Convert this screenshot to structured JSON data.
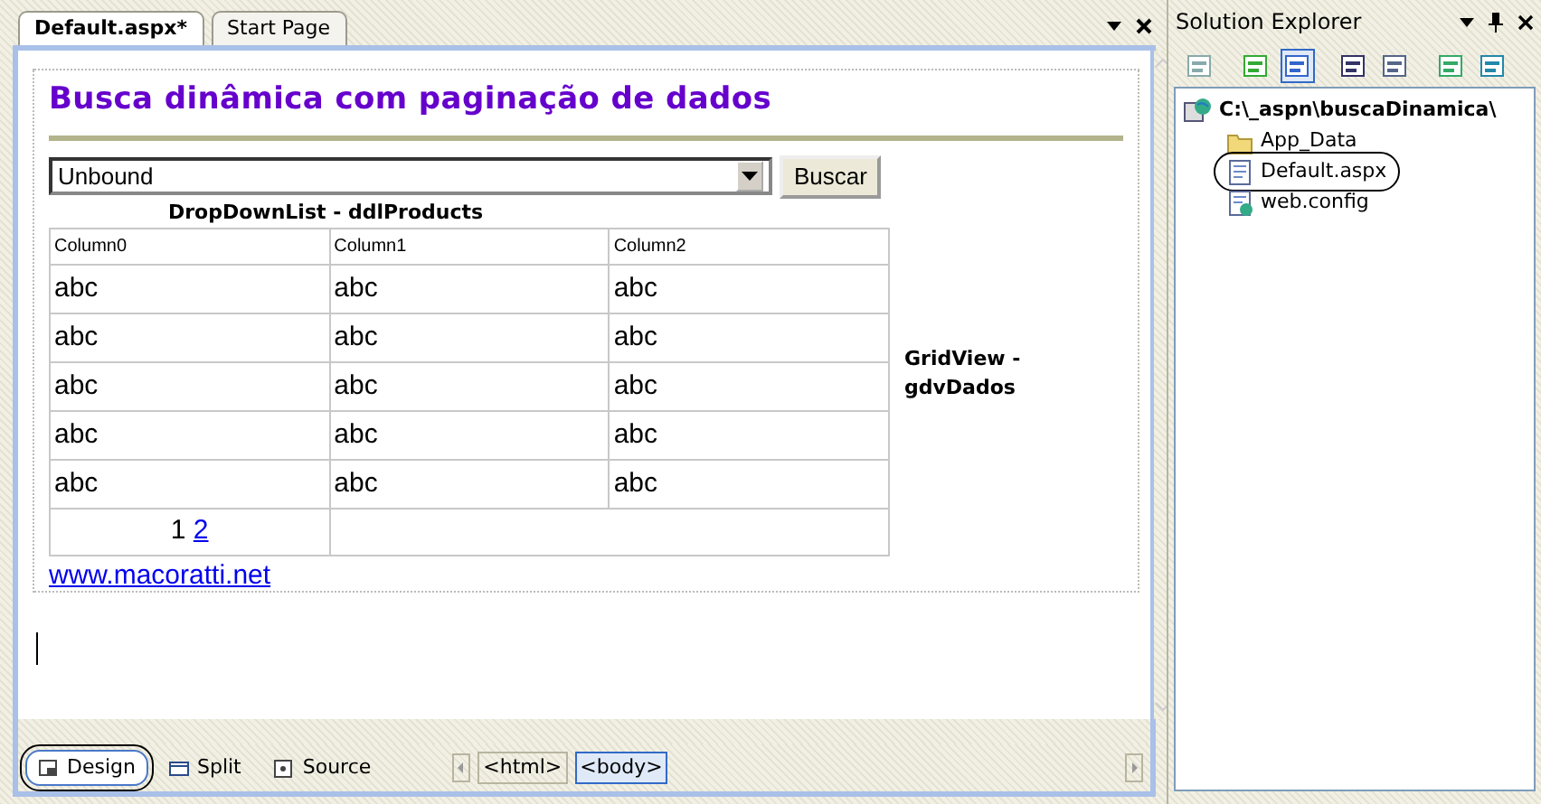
{
  "document_tabs": [
    {
      "label": "Default.aspx*",
      "selected": true
    },
    {
      "label": "Start Page",
      "selected": false
    }
  ],
  "page": {
    "heading": "Busca dinâmica com paginação de dados",
    "dropdown": {
      "value": "Unbound"
    },
    "search_button": "Buscar",
    "dropdown_caption": "DropDownList - ddlProducts",
    "grid": {
      "columns": [
        "Column0",
        "Column1",
        "Column2"
      ],
      "rows": [
        [
          "abc",
          "abc",
          "abc"
        ],
        [
          "abc",
          "abc",
          "abc"
        ],
        [
          "abc",
          "abc",
          "abc"
        ],
        [
          "abc",
          "abc",
          "abc"
        ],
        [
          "abc",
          "abc",
          "abc"
        ]
      ],
      "pager": [
        {
          "label": "1",
          "selected": true
        },
        {
          "label": "2",
          "selected": false
        }
      ]
    },
    "grid_caption": "GridView - gdvDados",
    "link": "www.macoratti.net"
  },
  "view_tabs": [
    {
      "label": "Design",
      "selected": true,
      "circled": true
    },
    {
      "label": "Split",
      "selected": false,
      "circled": false
    },
    {
      "label": "Source",
      "selected": false,
      "circled": false
    }
  ],
  "tag_path": [
    {
      "label": "<html>",
      "selected": false
    },
    {
      "label": "<body>",
      "selected": true
    }
  ],
  "solution_explorer": {
    "title": "Solution Explorer",
    "tree": {
      "label": "C:\\_aspn\\buscaDinamica\\",
      "children": [
        {
          "label": "App_Data",
          "kind": "folder",
          "circled": false
        },
        {
          "label": "Default.aspx",
          "kind": "page",
          "circled": true
        },
        {
          "label": "web.config",
          "kind": "config",
          "circled": false
        }
      ]
    }
  }
}
